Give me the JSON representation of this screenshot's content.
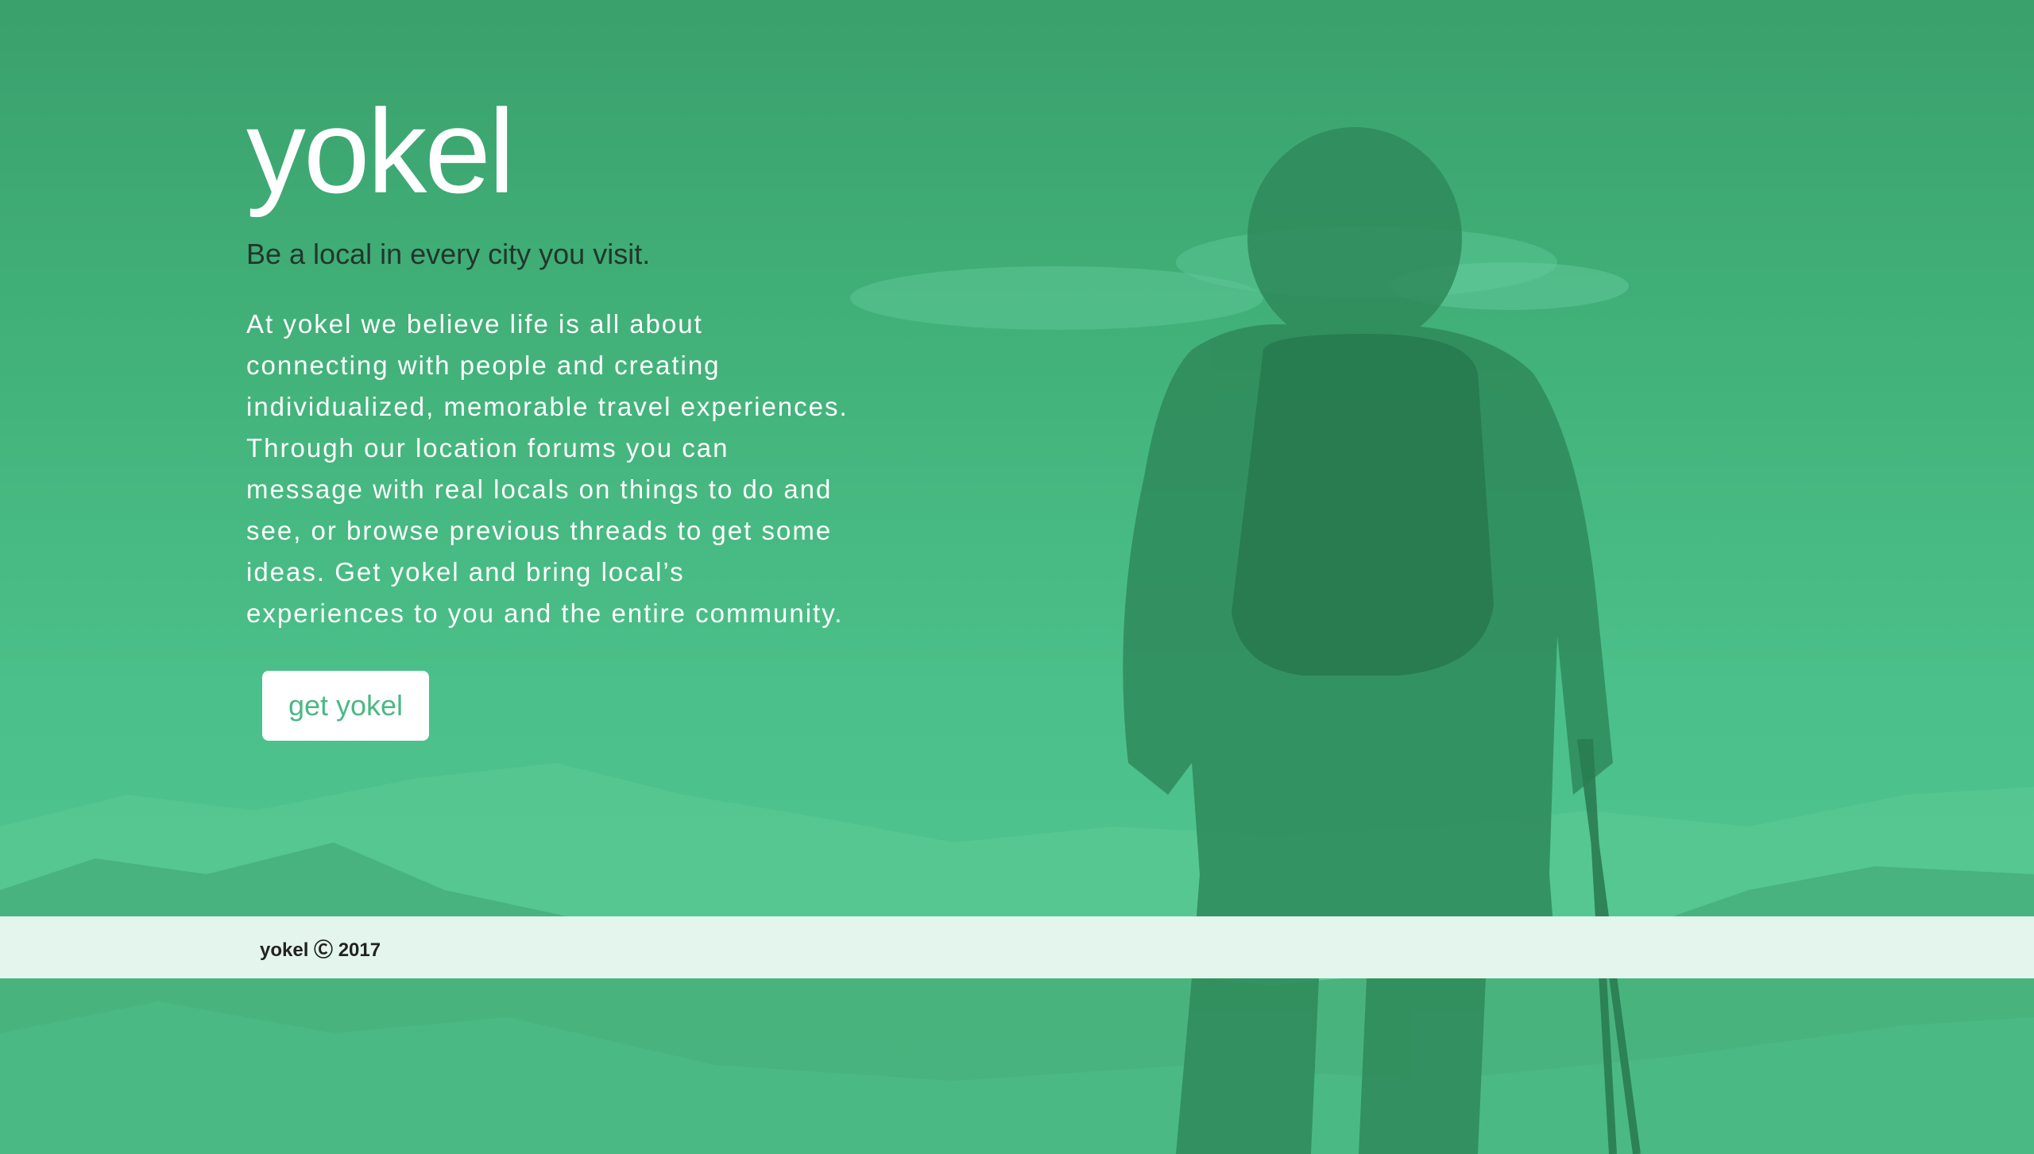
{
  "hero": {
    "brand": "yokel",
    "tagline": "Be a local in every city you visit.",
    "about": "At yokel we believe life is all about connecting with people and creating individualized, memorable travel experiences. Through our location forums you can message with real locals on things to do and see, or browse previous threads to get some ideas. Get yokel and bring local’s experiences to you and the entire community.",
    "cta_label": "get yokel"
  },
  "footer": {
    "copyright": "yokel Ⓒ 2017"
  },
  "colors": {
    "brand_green": "#4bb886",
    "overlay_green": "#43b47c",
    "footer_bg": "#e3f5ec"
  }
}
